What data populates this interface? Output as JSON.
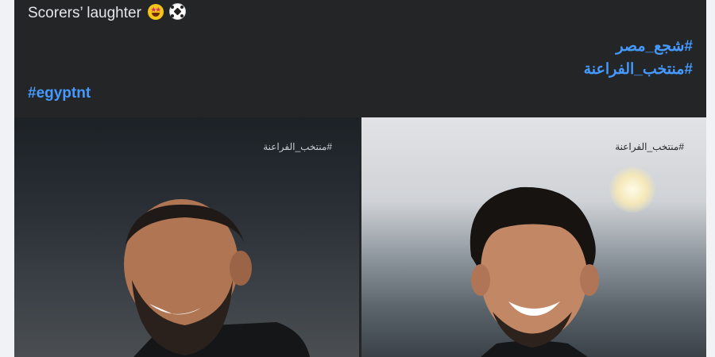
{
  "post": {
    "caption": "Scorers’ laughter",
    "caption_emojis": [
      "star-struck-icon",
      "soccer-ball-icon"
    ],
    "hashtags_rtl": [
      "#شجع_مصر",
      "#منتخب_الفراعنة"
    ],
    "hashtag_ltr": "#egyptnt",
    "link_color": "#4599ff",
    "background_color": "#242526"
  },
  "photos": [
    {
      "watermark": "#منتخب_الفراعنة"
    },
    {
      "watermark": "#منتخب_الفراعنة"
    }
  ]
}
